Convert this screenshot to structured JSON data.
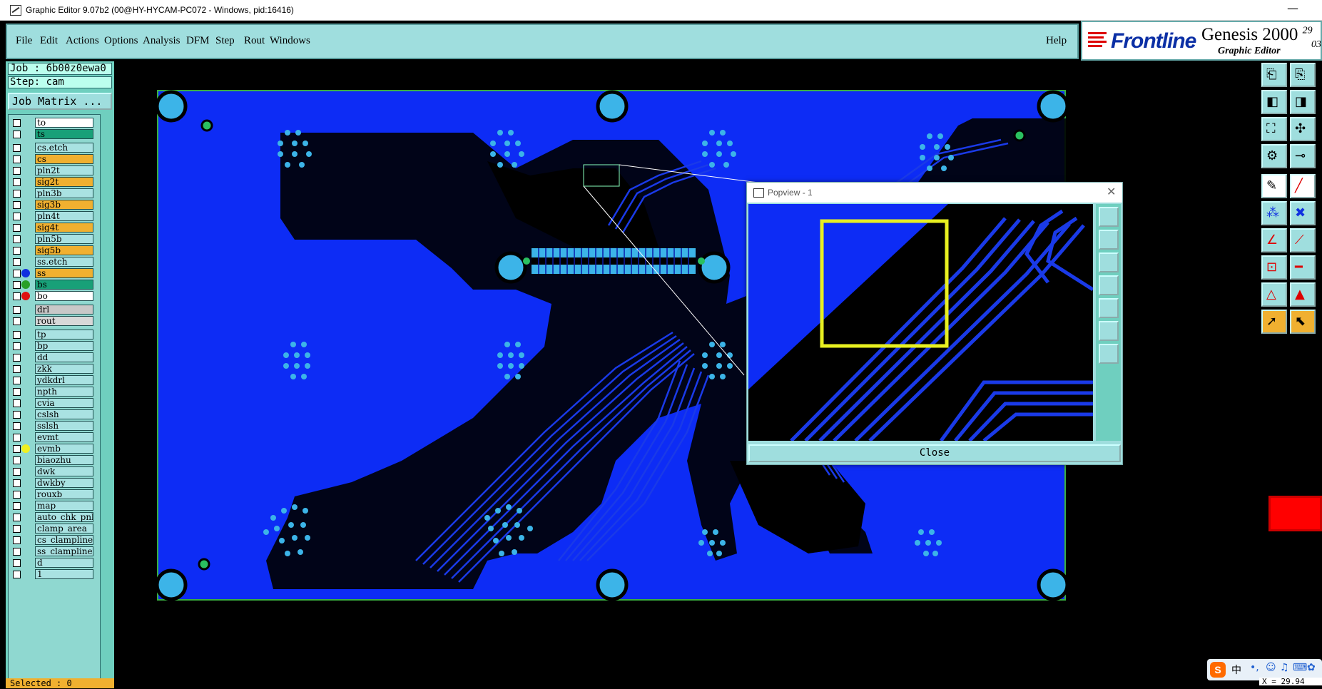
{
  "window": {
    "title": "Graphic Editor 9.07b2 (00@HY-HYCAM-PC072 - Windows, pid:16416)",
    "minimize_glyph": "—"
  },
  "menu": {
    "items": [
      "File",
      "Edit",
      "Actions",
      "Options",
      "Analysis",
      "DFM",
      "Step",
      "Rout",
      "Windows"
    ],
    "help": "Help"
  },
  "brand": {
    "logo": "Frontline",
    "product": "Genesis 2000",
    "sup": "29",
    "sub": "Graphic Editor",
    "extra": "03"
  },
  "job": {
    "job_label": "Job : 6b00z0ewa0",
    "step_label": "Step: cam",
    "matrix_button": "Job Matrix ..."
  },
  "layers": [
    {
      "name": "to",
      "color": "#ffffff",
      "dot": ""
    },
    {
      "name": "ts",
      "color": "#18a078",
      "dot": ""
    },
    {
      "name": "cs.etch",
      "color": "#a9e2e2",
      "dot": ""
    },
    {
      "name": "cs",
      "color": "#f0b030",
      "dot": ""
    },
    {
      "name": "pln2t",
      "color": "#a9e2e2",
      "dot": ""
    },
    {
      "name": "sig2t",
      "color": "#f0b030",
      "dot": ""
    },
    {
      "name": "pln3b",
      "color": "#a9e2e2",
      "dot": ""
    },
    {
      "name": "sig3b",
      "color": "#f0b030",
      "dot": ""
    },
    {
      "name": "pln4t",
      "color": "#a9e2e2",
      "dot": ""
    },
    {
      "name": "sig4t",
      "color": "#f0b030",
      "dot": ""
    },
    {
      "name": "pln5b",
      "color": "#a9e2e2",
      "dot": ""
    },
    {
      "name": "sig5b",
      "color": "#f0b030",
      "dot": ""
    },
    {
      "name": "ss.etch",
      "color": "#a9e2e2",
      "dot": ""
    },
    {
      "name": "ss",
      "color": "#f0b030",
      "dot": "#1030e0"
    },
    {
      "name": "bs",
      "color": "#18a078",
      "dot": "#28a028"
    },
    {
      "name": "bo",
      "color": "#ffffff",
      "dot": "#e01010"
    },
    {
      "name": "drl",
      "color": "#c8c8c8",
      "dot": ""
    },
    {
      "name": "rout",
      "color": "#d8d8d8",
      "dot": ""
    },
    {
      "name": "tp",
      "color": "#a9e2e2",
      "dot": ""
    },
    {
      "name": "bp",
      "color": "#a9e2e2",
      "dot": ""
    },
    {
      "name": "dd",
      "color": "#a9e2e2",
      "dot": ""
    },
    {
      "name": "zkk",
      "color": "#a9e2e2",
      "dot": ""
    },
    {
      "name": "ydkdrl",
      "color": "#a9e2e2",
      "dot": ""
    },
    {
      "name": "npth",
      "color": "#a9e2e2",
      "dot": ""
    },
    {
      "name": "cvia",
      "color": "#a9e2e2",
      "dot": ""
    },
    {
      "name": "cslsh",
      "color": "#a9e2e2",
      "dot": ""
    },
    {
      "name": "sslsh",
      "color": "#a9e2e2",
      "dot": ""
    },
    {
      "name": "evmt",
      "color": "#a9e2e2",
      "dot": ""
    },
    {
      "name": "evmb",
      "color": "#a9e2e2",
      "dot": "#f0f020"
    },
    {
      "name": "biaozhu",
      "color": "#a9e2e2",
      "dot": ""
    },
    {
      "name": "dwk",
      "color": "#a9e2e2",
      "dot": ""
    },
    {
      "name": "dwkby",
      "color": "#a9e2e2",
      "dot": ""
    },
    {
      "name": "rouxb",
      "color": "#a9e2e2",
      "dot": ""
    },
    {
      "name": "map",
      "color": "#a9e2e2",
      "dot": ""
    },
    {
      "name": "auto_chk_pnl",
      "color": "#a9e2e2",
      "dot": ""
    },
    {
      "name": "clamp_area",
      "color": "#a9e2e2",
      "dot": ""
    },
    {
      "name": "cs_clampline",
      "color": "#a9e2e2",
      "dot": ""
    },
    {
      "name": "ss_clampline",
      "color": "#a9e2e2",
      "dot": ""
    },
    {
      "name": "d",
      "color": "#a9e2e2",
      "dot": ""
    },
    {
      "name": "1",
      "color": "#a9e2e2",
      "dot": ""
    }
  ],
  "status": {
    "selected": "Selected : 0",
    "coord": "X = 29.94"
  },
  "popview": {
    "title": "Popview - 1",
    "close": "Close",
    "close_glyph": "✕"
  },
  "tray": {
    "ime_logo": "S",
    "ime_lang": "中"
  },
  "colors": {
    "board": "#0d2cf5",
    "track": "#0a1aa8",
    "pad": "#3cb4e8",
    "menu_bg": "#9fdede",
    "panel": "#6fcfbf"
  }
}
